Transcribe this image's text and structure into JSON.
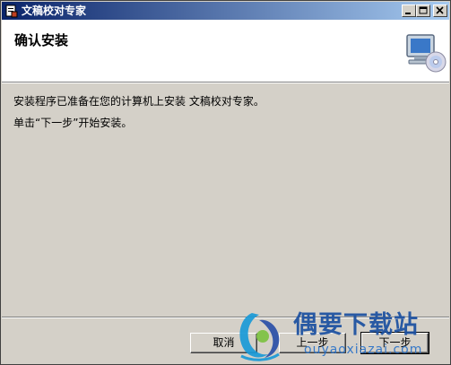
{
  "window": {
    "title": "文稿校对专家"
  },
  "header": {
    "title": "确认安装",
    "icon": "computer-cd-icon"
  },
  "body": {
    "line1": "安装程序已准备在您的计算机上安装 文稿校对专家。",
    "line2": "单击“下一步”开始安装。"
  },
  "buttons": {
    "cancel": "取消",
    "back": "上一步",
    "next": "下一步"
  },
  "watermark": {
    "brand": "偶要下载站",
    "url": "ouyaoxiazai.com"
  },
  "colors": {
    "titlebar_start": "#0a246a",
    "titlebar_end": "#a6caf0",
    "face": "#d4d0c8",
    "watermark": "#1a4fa0"
  }
}
